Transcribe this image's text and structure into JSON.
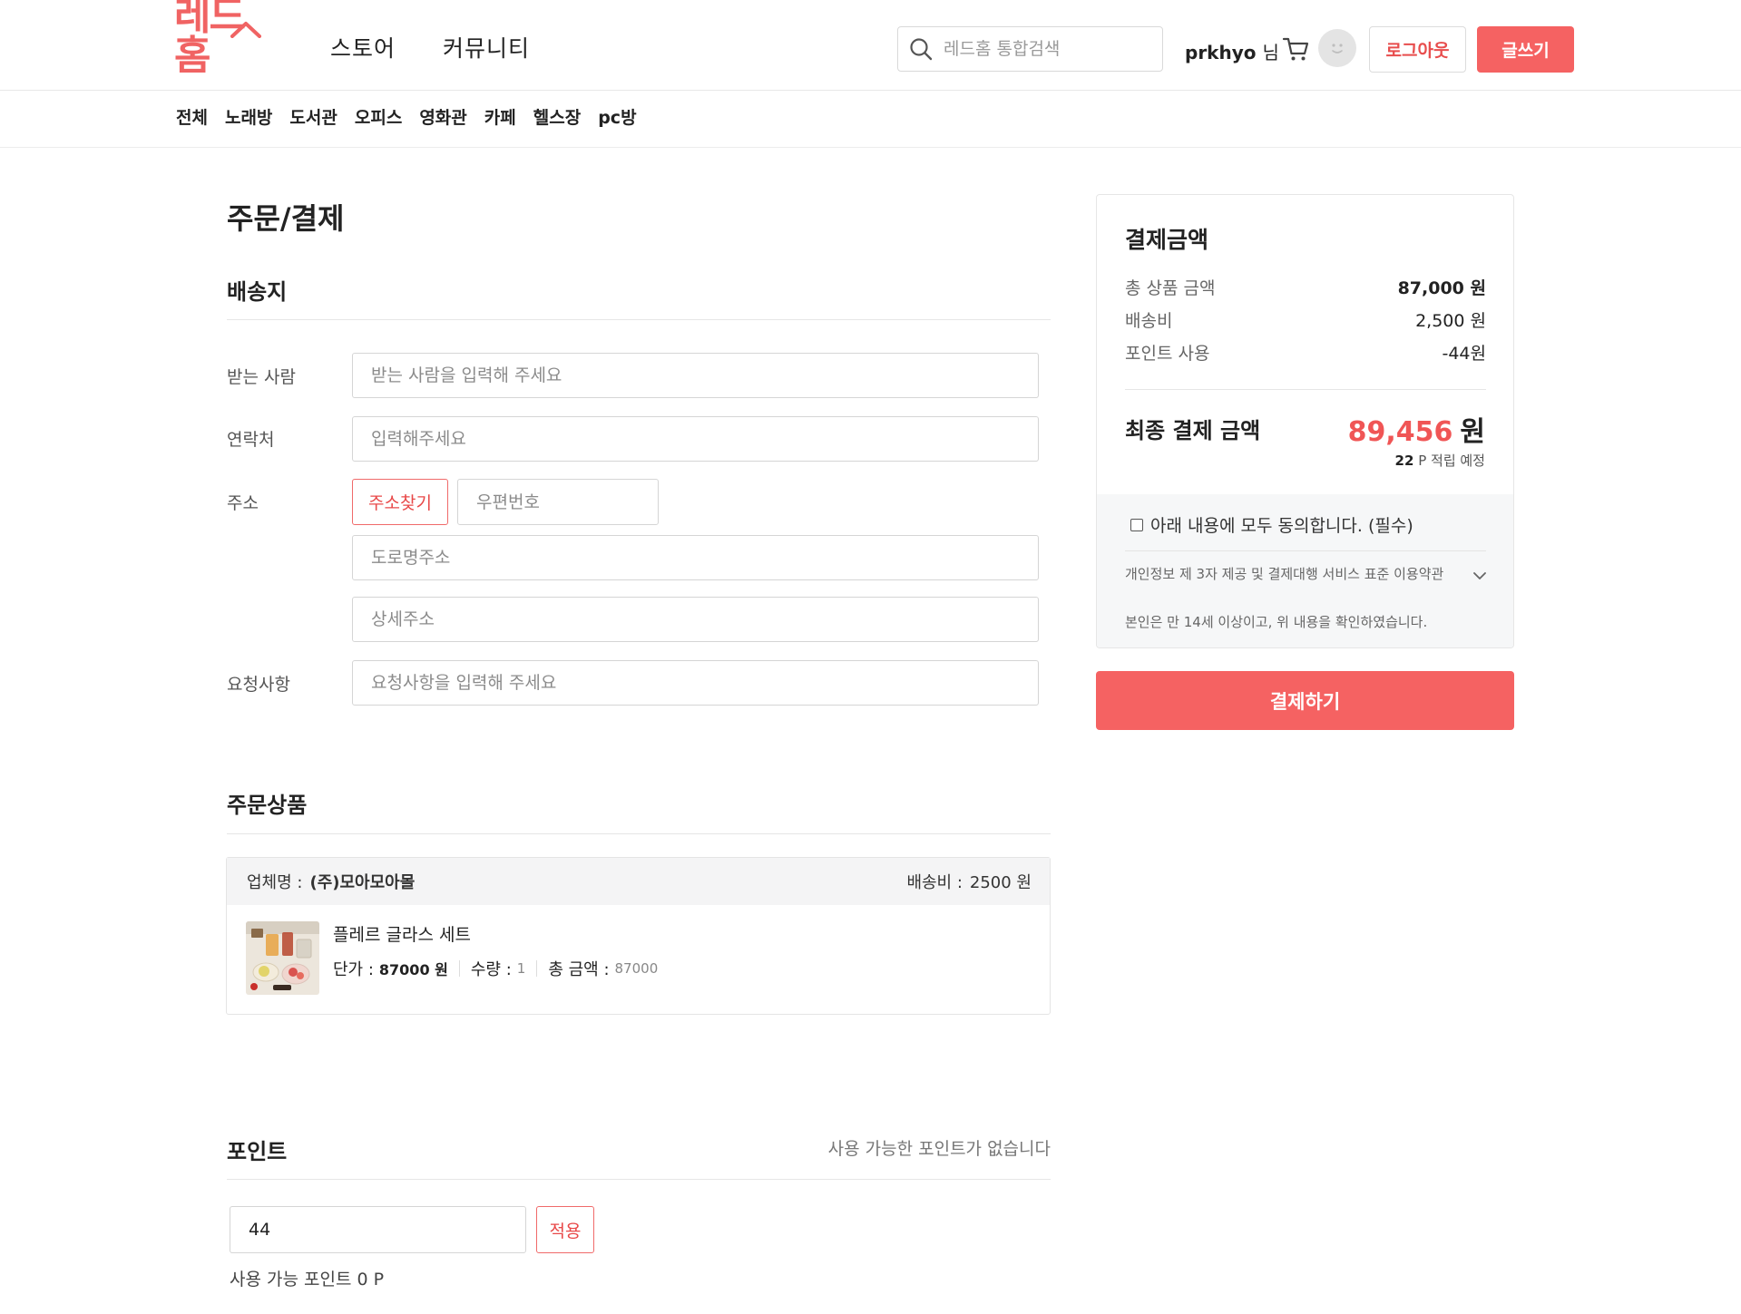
{
  "header": {
    "logo_text": "레드홈",
    "nav": [
      "스토어",
      "커뮤니티"
    ],
    "search_placeholder": "레드홈 통합검색",
    "user_name": "prkhyo",
    "user_suffix": "님",
    "logout_label": "로그아웃",
    "write_label": "글쓰기",
    "brand_color": "#f56262"
  },
  "subnav": [
    "전체",
    "노래방",
    "도서관",
    "오피스",
    "영화관",
    "카페",
    "헬스장",
    "pc방"
  ],
  "page": {
    "title": "주문/결제"
  },
  "shipping": {
    "title": "배송지",
    "recipient_label": "받는 사람",
    "recipient_placeholder": "받는 사람을 입력해 주세요",
    "contact_label": "연락처",
    "contact_placeholder": "입력해주세요",
    "address_label": "주소",
    "find_address_label": "주소찾기",
    "zipcode_placeholder": "우편번호",
    "road_address_placeholder": "도로명주소",
    "detail_address_placeholder": "상세주소",
    "request_label": "요청사항",
    "request_placeholder": "요청사항을 입력해 주세요"
  },
  "order": {
    "title": "주문상품",
    "vendor_label": "업체명 :",
    "vendor_name": "(주)모아모아몰",
    "shipping_fee_label": "배송비 :",
    "shipping_fee_value": "2500 원",
    "item": {
      "name": "플레르 글라스 세트",
      "unit_price_label": "단가 :",
      "unit_price_value": "87000 원",
      "qty_label": "수량 :",
      "qty_value": "1",
      "total_label": "총 금액 :",
      "total_value": "87000"
    }
  },
  "points": {
    "title": "포인트",
    "note": "사용 가능한 포인트가 없습니다",
    "input_value": "44",
    "apply_label": "적용",
    "available_text": "사용 가능 포인트 0 P"
  },
  "summary": {
    "title": "결제금액",
    "rows": [
      {
        "label": "총 상품 금액",
        "amount": "87,000 원"
      },
      {
        "label": "배송비",
        "amount": "2,500 원"
      },
      {
        "label": "포인트 사용",
        "amount": "-44원"
      }
    ],
    "final_label": "최종 결제 금액",
    "final_amount": "89,456",
    "final_unit": "원",
    "earn_points": "22",
    "earn_text": "P 적립 예정",
    "agree_text": "아래 내용에 모두 동의합니다. (필수)",
    "terms_text": "개인정보 제 3자 제공 및 결제대행 서비스 표준 이용약관",
    "confirm_text": "본인은 만 14세 이상이고, 위 내용을 확인하였습니다.",
    "pay_button": "결제하기",
    "accent_color": "#f05555"
  }
}
